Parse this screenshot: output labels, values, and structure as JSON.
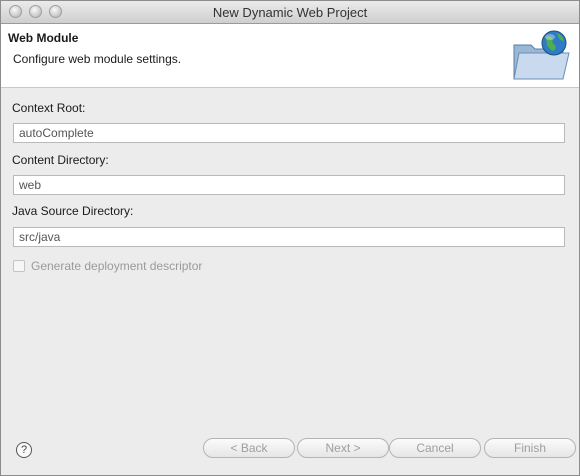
{
  "window": {
    "title": "New Dynamic Web Project"
  },
  "header": {
    "title": "Web Module",
    "description": "Configure web module settings."
  },
  "form": {
    "context_root": {
      "label": "Context Root:",
      "value": "autoComplete"
    },
    "content_directory": {
      "label": "Content Directory:",
      "value": "web"
    },
    "java_source_directory": {
      "label": "Java Source Directory:",
      "value": "src/java"
    },
    "generate_descriptor": {
      "label": "Generate deployment descriptor",
      "checked": false,
      "enabled": false
    }
  },
  "footer": {
    "help_symbol": "?",
    "back_label": "< Back",
    "next_label": "Next >",
    "cancel_label": "Cancel",
    "finish_label": "Finish"
  },
  "icons": {
    "header": "folder-globe-icon",
    "help": "help-icon"
  }
}
